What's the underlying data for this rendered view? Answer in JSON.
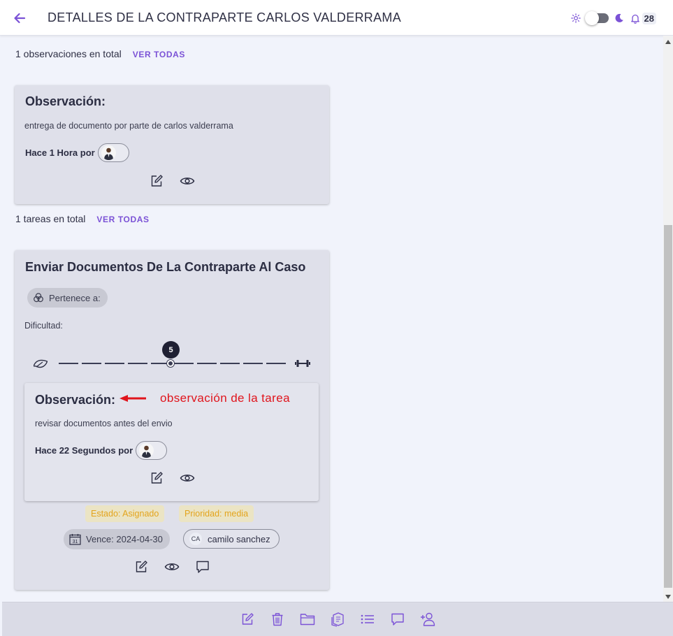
{
  "header": {
    "title": "DETALLES DE LA CONTRAPARTE CARLOS VALDERRAMA",
    "notification_count": "28"
  },
  "observations_section": {
    "count_text": "1 observaciones en total",
    "view_all_label": "VER TODAS",
    "card": {
      "title": "Observación:",
      "text": "entrega de documento por parte de carlos valderrama",
      "time_by": "Hace 1 Hora por"
    }
  },
  "tasks_section": {
    "count_text": "1 tareas en total",
    "view_all_label": "VER TODAS",
    "task": {
      "title": "Enviar Documentos De La Contraparte Al Caso",
      "belongs_to_label": "Pertenece a:",
      "difficulty_label": "Dificultad:",
      "difficulty_value": "5",
      "difficulty_level": 5,
      "difficulty_max": 10,
      "observation": {
        "title": "Observación:",
        "text": "revisar documentos antes del envio",
        "time_by": "Hace 22 Segundos por"
      },
      "status_label": "Estado: Asignado",
      "priority_label": "Prioridad: media",
      "due_label": "Vence: 2024-04-30",
      "calendar_day": "31",
      "assignee_initials": "CA",
      "assignee_name": "camilo sanchez"
    }
  },
  "annotation": {
    "text": "observación de la tarea",
    "color": "#e0141c"
  },
  "colors": {
    "accent": "#7b52d6",
    "card_bg": "#dfe0ea",
    "status_text": "#e3a41c"
  },
  "icons": {
    "header": [
      "back-arrow-icon",
      "sun-icon",
      "moon-icon",
      "bell-icon"
    ],
    "card_actions": [
      "edit-icon",
      "eye-icon",
      "comment-icon"
    ],
    "slider": [
      "leaf-icon",
      "dumbbell-icon"
    ],
    "bottom_bar": [
      "edit-icon",
      "trash-icon",
      "folder-icon",
      "copy-files-icon",
      "list-icon",
      "chat-icon",
      "add-user-icon"
    ]
  }
}
